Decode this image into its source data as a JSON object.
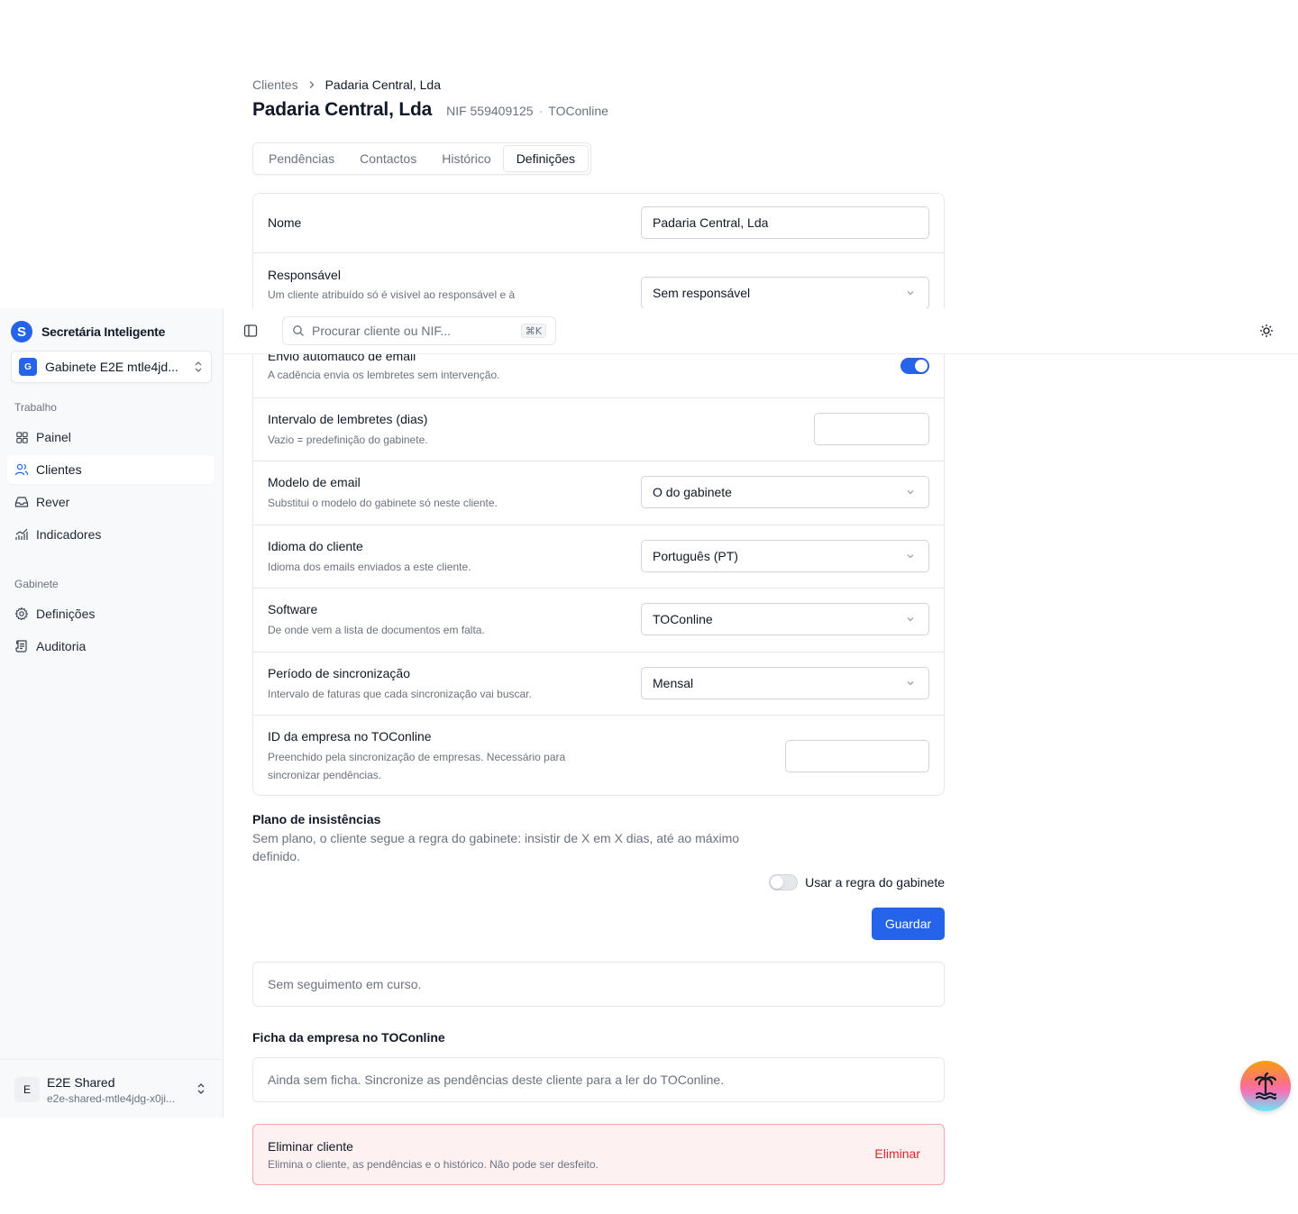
{
  "breadcrumb": {
    "root": "Clientes",
    "current": "Padaria Central, Lda"
  },
  "client": {
    "name": "Padaria Central, Lda",
    "nif": "NIF 559409125",
    "software": "TOConline"
  },
  "tabs": [
    "Pendências",
    "Contactos",
    "Histórico",
    "Definições"
  ],
  "active_tab": "Definições",
  "settings": {
    "name": {
      "label": "Nome",
      "value": "Padaria Central, Lda"
    },
    "owner": {
      "label": "Responsável",
      "desc": "Um cliente atribuído só é visível ao responsável e à",
      "value": "Sem responsável"
    },
    "auto_email": {
      "label": "Envio automático de email",
      "desc": "A cadência envia os lembretes sem intervenção.",
      "enabled": true
    },
    "interval": {
      "label": "Intervalo de lembretes (dias)",
      "desc": "Vazio = predefinição do gabinete.",
      "value": ""
    },
    "template": {
      "label": "Modelo de email",
      "desc": "Substitui o modelo do gabinete só neste cliente.",
      "value": "O do gabinete"
    },
    "language": {
      "label": "Idioma do cliente",
      "desc": "Idioma dos emails enviados a este cliente.",
      "value": "Português (PT)"
    },
    "software": {
      "label": "Software",
      "desc": "De onde vem a lista de documentos em falta.",
      "value": "TOConline"
    },
    "sync_period": {
      "label": "Período de sincronização",
      "desc": "Intervalo de faturas que cada sincronização vai buscar.",
      "value": "Mensal"
    },
    "company_id": {
      "label": "ID da empresa no TOConline",
      "desc": "Preenchido pela sincronização de empresas. Necessário para sincronizar pendências.",
      "value": ""
    }
  },
  "insistence": {
    "title": "Plano de insistências",
    "desc": "Sem plano, o cliente segue a regra do gabinete: insistir de X em X dias, até ao máximo definido.",
    "toggle_label": "Usar a regra do gabinete",
    "toggle_on": false,
    "save_label": "Guardar"
  },
  "followup_text": "Sem seguimento em curso.",
  "company_sheet": {
    "title": "Ficha da empresa no TOConline",
    "empty_text": "Ainda sem ficha. Sincronize as pendências deste cliente para a ler do TOConline."
  },
  "danger": {
    "title": "Eliminar cliente",
    "desc": "Elimina o cliente, as pendências e o histórico. Não pode ser desfeito.",
    "button": "Eliminar"
  },
  "sidebar": {
    "brand": "Secretária Inteligente",
    "brand_letter": "S",
    "office_badge": "G",
    "office": "Gabinete E2E mtle4jd...",
    "group_work": "Trabalho",
    "work_items": [
      {
        "label": "Painel",
        "icon": "grid-icon"
      },
      {
        "label": "Clientes",
        "icon": "users-icon"
      },
      {
        "label": "Rever",
        "icon": "inbox-icon"
      },
      {
        "label": "Indicadores",
        "icon": "chart-icon"
      }
    ],
    "group_office": "Gabinete",
    "office_items": [
      {
        "label": "Definições",
        "icon": "gear-icon"
      },
      {
        "label": "Auditoria",
        "icon": "scroll-icon"
      }
    ],
    "user": {
      "initial": "E",
      "name": "E2E Shared",
      "email": "e2e-shared-mtle4jdg-x0ji..."
    }
  },
  "topbar": {
    "search_placeholder": "Procurar cliente ou NIF...",
    "shortcut": "⌘K"
  },
  "colors": {
    "accent": "#2563eb",
    "danger": "#dc2626",
    "danger_bg": "#fdf1f2"
  }
}
